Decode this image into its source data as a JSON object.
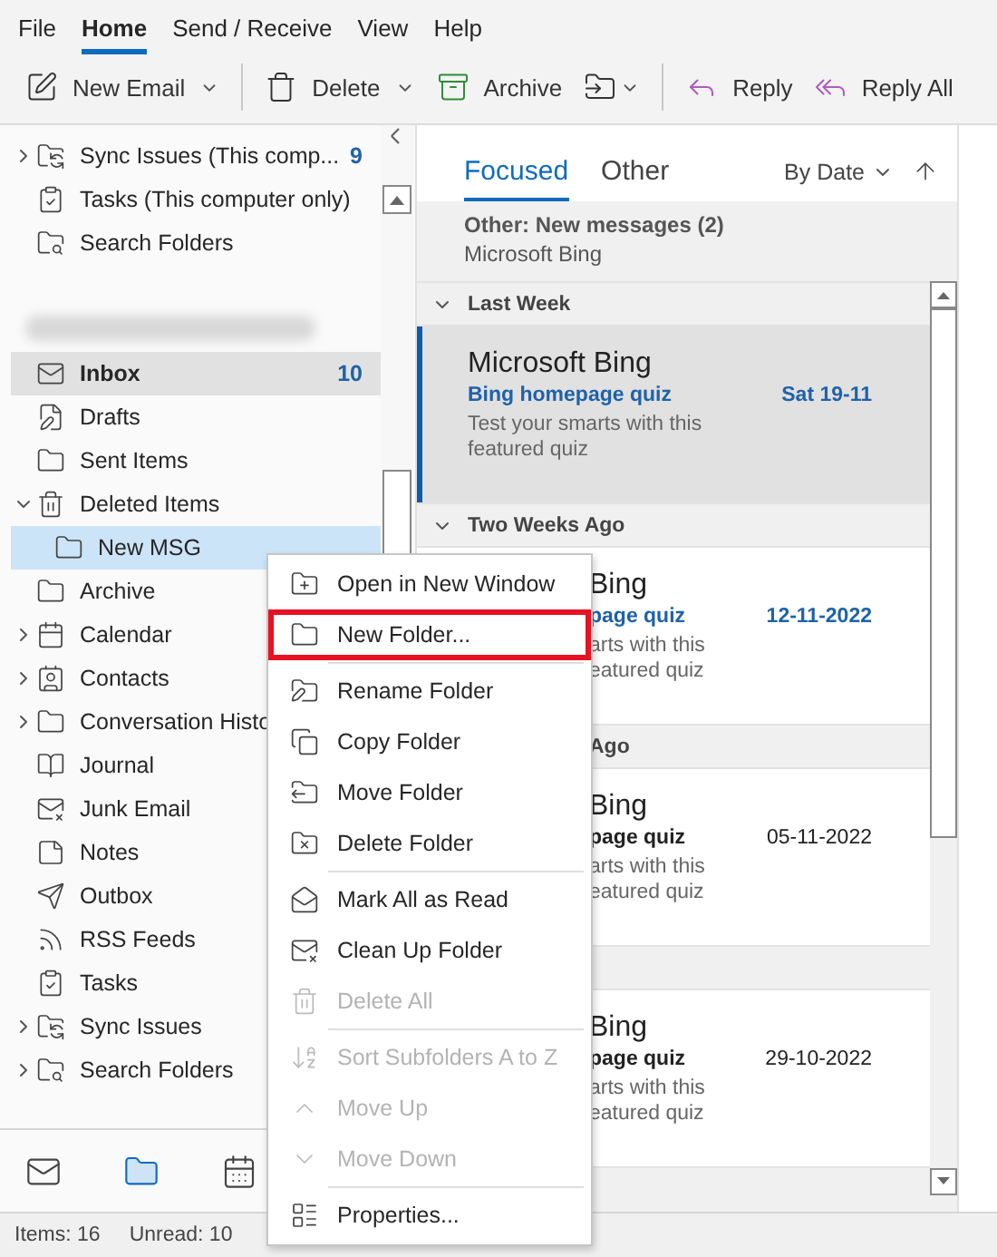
{
  "menu_tabs": [
    {
      "label": "File",
      "selected": false
    },
    {
      "label": "Home",
      "selected": true
    },
    {
      "label": "Send / Receive",
      "selected": false
    },
    {
      "label": "View",
      "selected": false
    },
    {
      "label": "Help",
      "selected": false
    }
  ],
  "toolbar": [
    {
      "kind": "new-email",
      "label": "New Email",
      "dropdown": true
    },
    {
      "kind": "separator"
    },
    {
      "kind": "delete",
      "label": "Delete",
      "dropdown": true
    },
    {
      "kind": "archive",
      "label": "Archive",
      "dropdown": false
    },
    {
      "kind": "move",
      "dropdown": true
    },
    {
      "kind": "separator"
    },
    {
      "kind": "reply",
      "label": "Reply",
      "dropdown": false
    },
    {
      "kind": "reply-all",
      "label": "Reply All",
      "dropdown": false
    }
  ],
  "folders": {
    "sections": [
      {
        "kind": "plain",
        "items": [
          {
            "kind": "sync",
            "label": "Sync Issues (This comp...",
            "count": "9",
            "expanded": false,
            "selected": false
          },
          {
            "kind": "tasks",
            "label": "Tasks (This computer only)",
            "selected": false
          },
          {
            "kind": "search",
            "label": "Search Folders",
            "selected": false
          }
        ]
      },
      {
        "kind": "account",
        "items": [
          {
            "kind": "inbox",
            "label": "Inbox",
            "count": "10",
            "selected": false,
            "current": true
          },
          {
            "kind": "drafts",
            "label": "Drafts",
            "selected": false
          },
          {
            "kind": "folder",
            "label": "Sent Items",
            "selected": false
          },
          {
            "kind": "trash",
            "label": "Deleted Items",
            "expanded": true,
            "selected": false,
            "children": [
              {
                "kind": "folder",
                "label": "New MSG",
                "selected": true
              }
            ]
          },
          {
            "kind": "folder",
            "label": "Archive",
            "selected": false
          },
          {
            "kind": "calendar",
            "label": "Calendar",
            "expanded": false,
            "selected": false
          },
          {
            "kind": "contacts",
            "label": "Contacts",
            "expanded": false,
            "selected": false
          },
          {
            "kind": "folder",
            "label": "Conversation Histo",
            "expanded": false,
            "selected": false
          },
          {
            "kind": "journal",
            "label": "Journal",
            "selected": false
          },
          {
            "kind": "junk",
            "label": "Junk Email",
            "selected": false
          },
          {
            "kind": "notes",
            "label": "Notes",
            "selected": false
          },
          {
            "kind": "outbox",
            "label": "Outbox",
            "selected": false
          },
          {
            "kind": "rss",
            "label": "RSS Feeds",
            "selected": false
          },
          {
            "kind": "tasks",
            "label": "Tasks",
            "selected": false
          },
          {
            "kind": "sync",
            "label": "Sync Issues",
            "expanded": false,
            "selected": false
          },
          {
            "kind": "search",
            "label": "Search Folders",
            "expanded": false,
            "selected": false
          }
        ]
      }
    ]
  },
  "nav": [
    {
      "kind": "mail",
      "selected": false
    },
    {
      "kind": "folders",
      "selected": true
    },
    {
      "kind": "calendar",
      "selected": false
    }
  ],
  "message_list": {
    "tabs": [
      {
        "label": "Focused",
        "selected": true
      },
      {
        "label": "Other",
        "selected": false
      }
    ],
    "sort": "By Date",
    "other_banner": {
      "title": "Other: New messages (2)",
      "sender": "Microsoft Bing"
    },
    "groups": [
      {
        "label": "Last Week",
        "messages": [
          {
            "kind": "full",
            "sender": "Microsoft Bing",
            "subject": "Bing homepage quiz",
            "date": "Sat 19-11",
            "preview": [
              "Test your smarts with this",
              "featured quiz"
            ],
            "unread": true,
            "selected": true
          }
        ]
      },
      {
        "label": "Two Weeks Ago",
        "messages": [
          {
            "kind": "partial",
            "sender": "Bing",
            "subject": "page quiz",
            "date": "12-11-2022",
            "preview": [
              "arts with this",
              "eatured quiz"
            ],
            "unread": true,
            "selected": false
          }
        ]
      },
      {
        "label": "Ago",
        "kind": "partial",
        "messages": [
          {
            "kind": "partial",
            "sender": "Bing",
            "subject": "page quiz",
            "date": "05-11-2022",
            "preview": [
              "arts with this",
              "eatured quiz"
            ],
            "unread": false,
            "selected": false
          }
        ]
      },
      {
        "messages": [
          {
            "kind": "partial",
            "sender": "Bing",
            "subject": "page quiz",
            "date": "29-10-2022",
            "preview": [
              "arts with this",
              "eatured quiz"
            ],
            "unread": false,
            "selected": false
          }
        ]
      }
    ]
  },
  "status_bar": {
    "items": "Items: 16",
    "unread": "Unread: 10"
  },
  "context_menu": {
    "groups": [
      [
        {
          "kind": "open-window",
          "label": "Open in New Window",
          "disabled": false
        },
        {
          "kind": "new-folder",
          "label": "New Folder...",
          "disabled": false,
          "outlined": true
        }
      ],
      [
        {
          "kind": "rename",
          "label": "Rename Folder",
          "disabled": false
        },
        {
          "kind": "copy",
          "label": "Copy Folder",
          "disabled": false
        },
        {
          "kind": "move",
          "label": "Move Folder",
          "disabled": false
        },
        {
          "kind": "delete",
          "label": "Delete Folder",
          "disabled": false
        }
      ],
      [
        {
          "kind": "mark-read",
          "label": "Mark All as Read",
          "disabled": false
        },
        {
          "kind": "clean",
          "label": "Clean Up Folder",
          "disabled": false
        },
        {
          "kind": "delete-all",
          "label": "Delete All",
          "disabled": true
        }
      ],
      [
        {
          "kind": "sort",
          "label": "Sort Subfolders A to Z",
          "disabled": true
        },
        {
          "kind": "up",
          "label": "Move Up",
          "disabled": true
        },
        {
          "kind": "down",
          "label": "Move Down",
          "disabled": true
        }
      ],
      [
        {
          "kind": "properties",
          "label": "Properties...",
          "disabled": false
        }
      ]
    ]
  }
}
